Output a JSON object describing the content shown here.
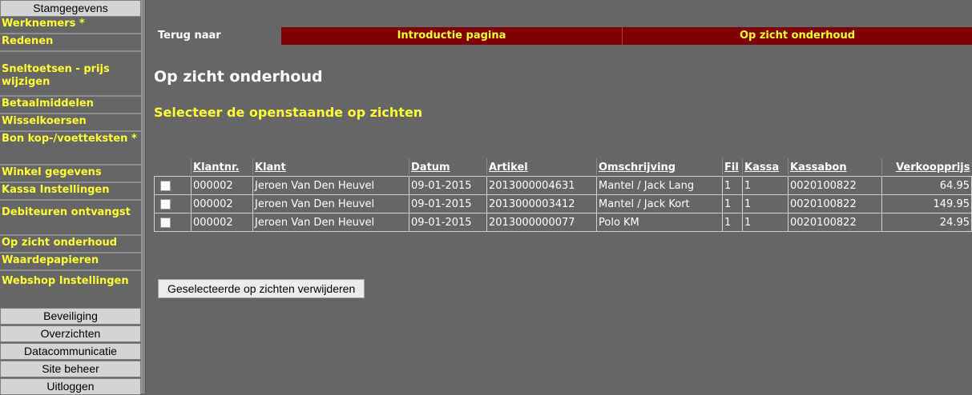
{
  "sidebar": {
    "header_top": "Stamgegevens",
    "items": [
      {
        "label": "Werknemers *"
      },
      {
        "label": "Redenen"
      },
      {
        "label": "Sneltoetsen - prijs wijzigen"
      },
      {
        "label": "Betaalmiddelen"
      },
      {
        "label": "Wisselkoersen"
      },
      {
        "label": "Bon kop-/voetteksten *"
      },
      {
        "label": "Winkel gegevens"
      },
      {
        "label": "Kassa Instellingen"
      },
      {
        "label": "Debiteuren ontvangst"
      },
      {
        "label": "Op zicht onderhoud"
      },
      {
        "label": "Waardepapieren"
      },
      {
        "label": "Webshop Instellingen"
      }
    ],
    "headers_bottom": [
      {
        "label": "Beveiliging"
      },
      {
        "label": "Overzichten"
      },
      {
        "label": "Datacommunicatie"
      },
      {
        "label": "Site beheer"
      },
      {
        "label": "Uitloggen"
      }
    ]
  },
  "nav": {
    "label": "Terug naar",
    "links": [
      {
        "label": "Introductie pagina"
      },
      {
        "label": "Op zicht onderhoud"
      }
    ]
  },
  "page": {
    "title": "Op zicht onderhoud",
    "subtitle": "Selecteer de openstaande op zichten"
  },
  "table": {
    "columns": [
      "Klantnr.",
      "Klant",
      "Datum",
      "Artikel",
      "Omschrijving",
      "Fil",
      "Kassa",
      "Kassabon",
      "Verkoopprijs"
    ],
    "rows": [
      [
        "000002",
        "Jeroen Van Den Heuvel",
        "09-01-2015",
        "2013000004631",
        "Mantel / Jack Lang",
        "1",
        "1",
        "0020100822",
        "64.95"
      ],
      [
        "000002",
        "Jeroen Van Den Heuvel",
        "09-01-2015",
        "2013000003412",
        "Mantel / Jack Kort",
        "1",
        "1",
        "0020100822",
        "149.95"
      ],
      [
        "000002",
        "Jeroen Van Den Heuvel",
        "09-01-2015",
        "2013000000077",
        "Polo KM",
        "1",
        "1",
        "0020100822",
        "24.95"
      ]
    ]
  },
  "actions": {
    "delete_label": "Geselecteerde op zichten verwijderen"
  },
  "colors": {
    "background": "#666666",
    "accent_text": "#ffff33",
    "nav_bar": "#7f0000"
  }
}
